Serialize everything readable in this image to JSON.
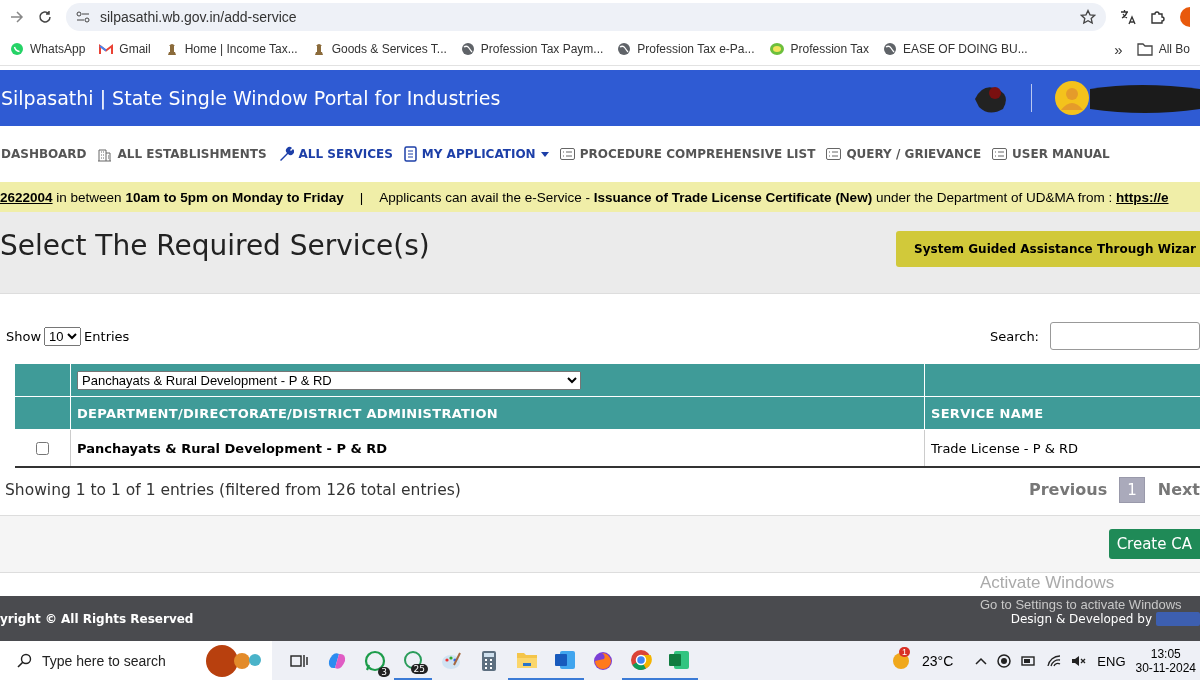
{
  "browser": {
    "url": "silpasathi.wb.gov.in/add-service",
    "bookmarks": [
      {
        "label": "WhatsApp",
        "kind": "whatsapp"
      },
      {
        "label": "Gmail",
        "kind": "gmail"
      },
      {
        "label": "Home | Income Tax...",
        "kind": "emblem"
      },
      {
        "label": "Goods & Services T...",
        "kind": "emblem"
      },
      {
        "label": "Profession Tax Paym...",
        "kind": "globe"
      },
      {
        "label": "Profession Tax e-Pa...",
        "kind": "globe"
      },
      {
        "label": "Profession Tax",
        "kind": "seal"
      },
      {
        "label": "EASE OF DOING BU...",
        "kind": "globe"
      }
    ],
    "more": "»",
    "all_bookmarks": "All Bo"
  },
  "header": {
    "title": "Silpasathi | State Single Window Portal for Industries"
  },
  "nav": [
    {
      "label": "DASHBOARD",
      "kind": "plain",
      "selected": false,
      "dropdown": false
    },
    {
      "label": "ALL ESTABLISHMENTS",
      "kind": "building",
      "selected": false,
      "dropdown": false
    },
    {
      "label": "ALL SERVICES",
      "kind": "wrench",
      "selected": true,
      "dropdown": false
    },
    {
      "label": "MY APPLICATION",
      "kind": "doc",
      "selected": true,
      "dropdown": true
    },
    {
      "label": "PROCEDURE COMPREHENSIVE LIST",
      "kind": "list",
      "selected": false,
      "dropdown": false
    },
    {
      "label": "QUERY / GRIEVANCE",
      "kind": "list",
      "selected": false,
      "dropdown": false
    },
    {
      "label": "USER MANUAL",
      "kind": "list",
      "selected": false,
      "dropdown": false
    }
  ],
  "ticker": {
    "text": "**2622004** in between **10am to 5pm on Monday to Friday**",
    "separator": "|",
    "text2": "Applicants can avail the e-Service - **Issuance of Trade License Certificate (New)** under the Department of UD&MA from :",
    "link": "https://e"
  },
  "page_title": "Select The Required Service(s)",
  "wizard_button": "System Guided Assistance Through Wizar",
  "table_controls": {
    "show_label": "Show",
    "page_size": "10",
    "entries_label": "Entries",
    "search_label": "Search:"
  },
  "table": {
    "filter": "Panchayats & Rural Development - P & RD",
    "columns": [
      "DEPARTMENT/DIRECTORATE/DISTRICT ADMINISTRATION",
      "SERVICE NAME"
    ],
    "rows": [
      {
        "checked": false,
        "department": "Panchayats & Rural Development - P & RD",
        "service": "Trade License - P & RD"
      }
    ]
  },
  "info": "Showing 1 to 1 of 1 entries (filtered from 126 total entries)",
  "pagination": [
    {
      "label": "Previous",
      "kind": "nav",
      "selected": false
    },
    {
      "label": "1",
      "kind": "page",
      "selected": true
    },
    {
      "label": "Next",
      "kind": "nav",
      "selected": false
    }
  ],
  "create_button": "Create CA",
  "footer": {
    "copyright": "yright © All Rights Reserved",
    "credit": "Design & Developed by"
  },
  "activation": {
    "title": "Activate Windows",
    "subtitle": "Go to Settings to activate Windows"
  },
  "taskbar": {
    "search_placeholder": "Type here to search",
    "apps": [
      {
        "kind": "taskview",
        "active": false
      },
      {
        "kind": "copilot",
        "active": false
      },
      {
        "kind": "whatsapp",
        "badge": "3",
        "active": false
      },
      {
        "kind": "chat",
        "badge": "25",
        "active": true
      },
      {
        "kind": "paint",
        "active": false
      },
      {
        "kind": "calculator",
        "active": false
      },
      {
        "kind": "folder",
        "active": true
      },
      {
        "kind": "word",
        "active": true
      },
      {
        "kind": "firefox",
        "active": false
      },
      {
        "kind": "chrome",
        "active": true
      },
      {
        "kind": "excel",
        "active": true
      }
    ],
    "weather": "23°C",
    "weather_badge": "1",
    "language": "ENG",
    "time": "13:05",
    "date": "30-11-2024"
  }
}
